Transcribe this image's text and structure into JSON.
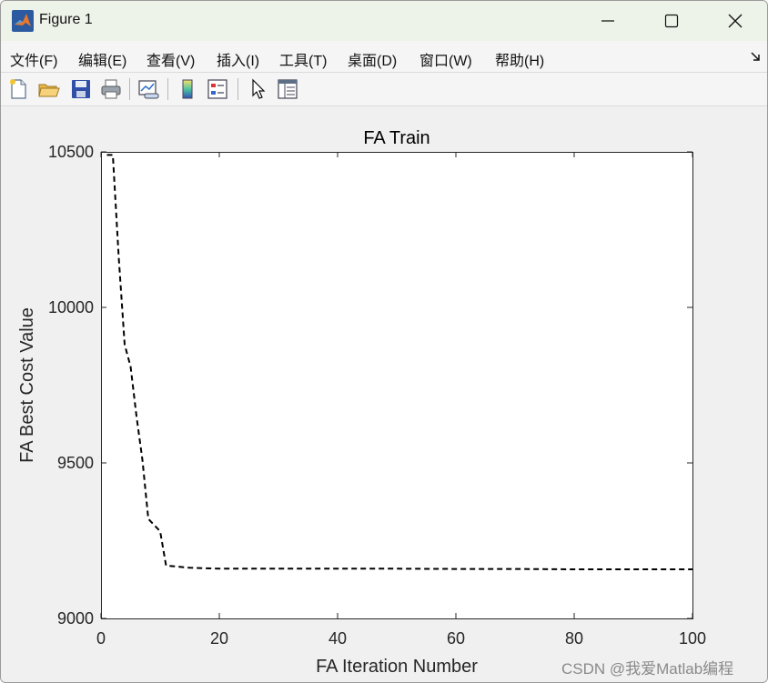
{
  "window": {
    "title": "Figure 1",
    "minimize_glyph": "minimize-icon",
    "maximize_glyph": "maximize-icon",
    "close_glyph": "close-icon"
  },
  "menu": {
    "items": [
      "文件(F)",
      "编辑(E)",
      "查看(V)",
      "插入(I)",
      "工具(T)",
      "桌面(D)",
      "窗口(W)",
      "帮助(H)"
    ]
  },
  "toolbar": {
    "buttons": [
      "new-figure-icon",
      "open-file-icon",
      "save-icon",
      "print-icon",
      "link-plot-icon",
      "colorbar-icon",
      "legend-icon",
      "pointer-icon",
      "property-inspector-icon"
    ]
  },
  "watermark": "CSDN @我爱Matlab编程",
  "chart_data": {
    "type": "line",
    "title": "FA Train",
    "xlabel": "FA Iteration Number",
    "ylabel": "FA Best Cost Value",
    "xlim": [
      0,
      100
    ],
    "ylim": [
      9000,
      10500
    ],
    "xticks": [
      "0",
      "20",
      "40",
      "60",
      "80",
      "100"
    ],
    "yticks": [
      "9000",
      "9500",
      "10000",
      "10500"
    ],
    "grid": false,
    "line_style": "dashed",
    "line_color": "#000000",
    "series": [
      {
        "x": [
          1,
          2,
          3,
          4,
          5,
          6,
          7,
          8,
          9,
          10,
          11,
          12,
          15,
          20,
          30,
          40,
          50,
          60,
          70,
          80,
          90,
          100
        ],
        "values": [
          10490,
          10490,
          10160,
          9880,
          9810,
          9650,
          9510,
          9320,
          9300,
          9280,
          9170,
          9168,
          9163,
          9160,
          9160,
          9160,
          9160,
          9159,
          9159,
          9158,
          9158,
          9158
        ]
      }
    ]
  }
}
